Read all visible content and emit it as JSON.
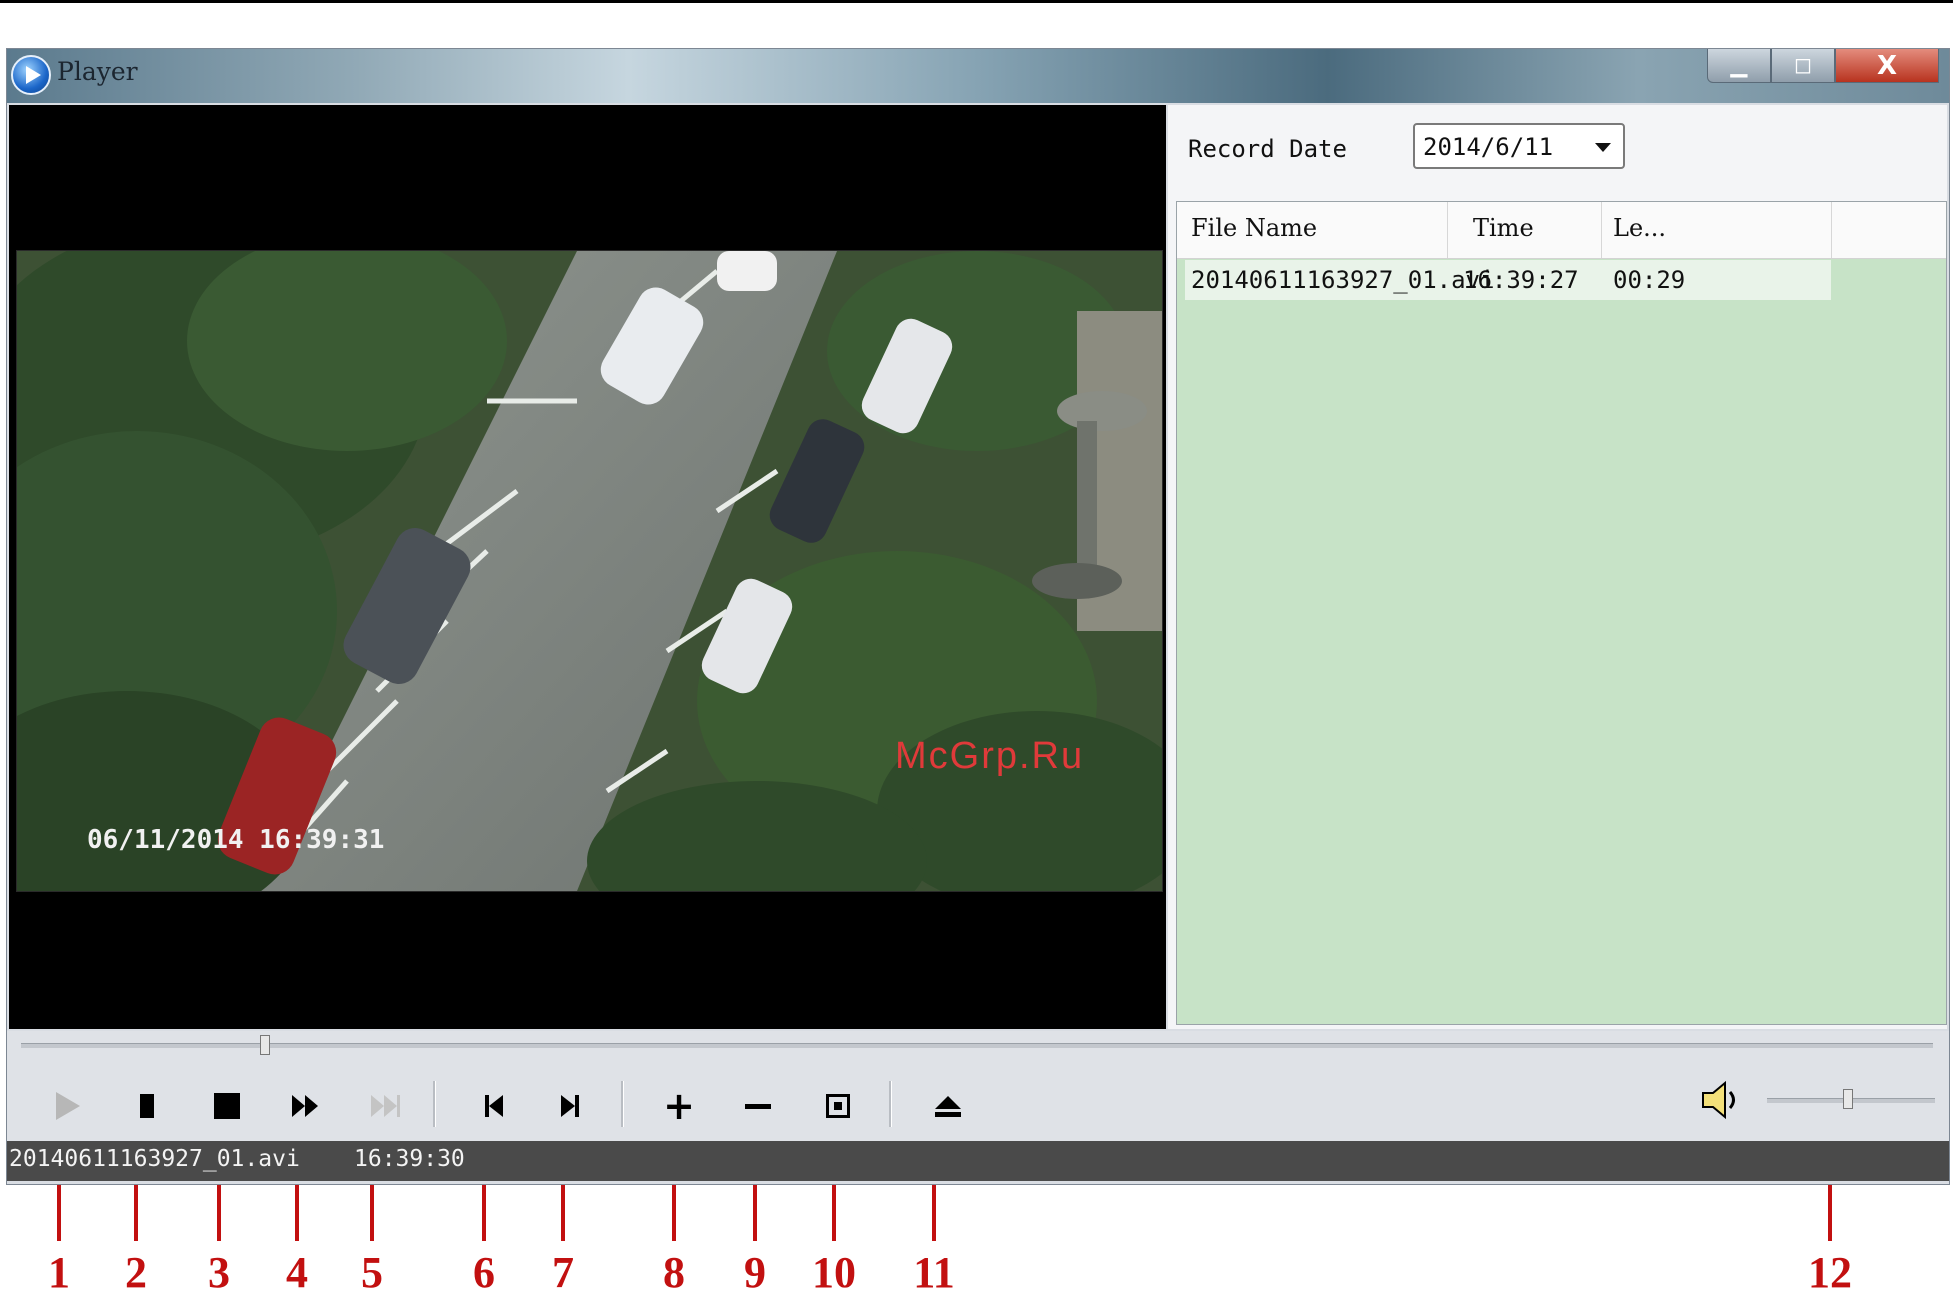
{
  "window": {
    "title": "Player",
    "minimize_icon": "minimize-icon",
    "maximize_icon": "maximize-icon",
    "close_label": "X"
  },
  "video": {
    "osd_timestamp": "06/11/2014  16:39:31",
    "watermark": "McGrp.Ru"
  },
  "panel": {
    "record_date_label": "Record Date",
    "record_date_value": "2014/6/11",
    "columns": [
      "File Name",
      "Time",
      "Le..."
    ],
    "rows": [
      {
        "file": "20140611163927_01.avi",
        "time": "16:39:27",
        "length": "00:29"
      }
    ],
    "list_bg": "#c7e3c7"
  },
  "controls": {
    "seek_fraction": 0.125,
    "volume_fraction": 0.45,
    "buttons": [
      {
        "name": "play-button",
        "icon": "play-icon"
      },
      {
        "name": "pause-button",
        "icon": "pause-icon"
      },
      {
        "name": "stop-button",
        "icon": "stop-icon"
      },
      {
        "name": "fast-forward-button",
        "icon": "fast-forward-icon"
      },
      {
        "name": "fastest-forward-button",
        "icon": "skip-end-icon"
      },
      {
        "name": "previous-frame-button",
        "icon": "previous-frame-icon"
      },
      {
        "name": "next-frame-button",
        "icon": "next-frame-icon"
      },
      {
        "name": "zoom-in-button",
        "icon": "plus-icon"
      },
      {
        "name": "zoom-out-button",
        "icon": "minus-icon"
      },
      {
        "name": "fit-screen-button",
        "icon": "fit-screen-icon"
      },
      {
        "name": "eject-button",
        "icon": "eject-icon"
      }
    ],
    "speaker_icon": "speaker-icon",
    "plus_symbol": "+"
  },
  "status": {
    "file": "20140611163927_01.avi",
    "time": "16:39:30"
  },
  "callouts": [
    "1",
    "2",
    "3",
    "4",
    "5",
    "6",
    "7",
    "8",
    "9",
    "10",
    "11",
    "12"
  ],
  "colors": {
    "callout": "#c21010",
    "title_bar": "#7f9bab"
  }
}
